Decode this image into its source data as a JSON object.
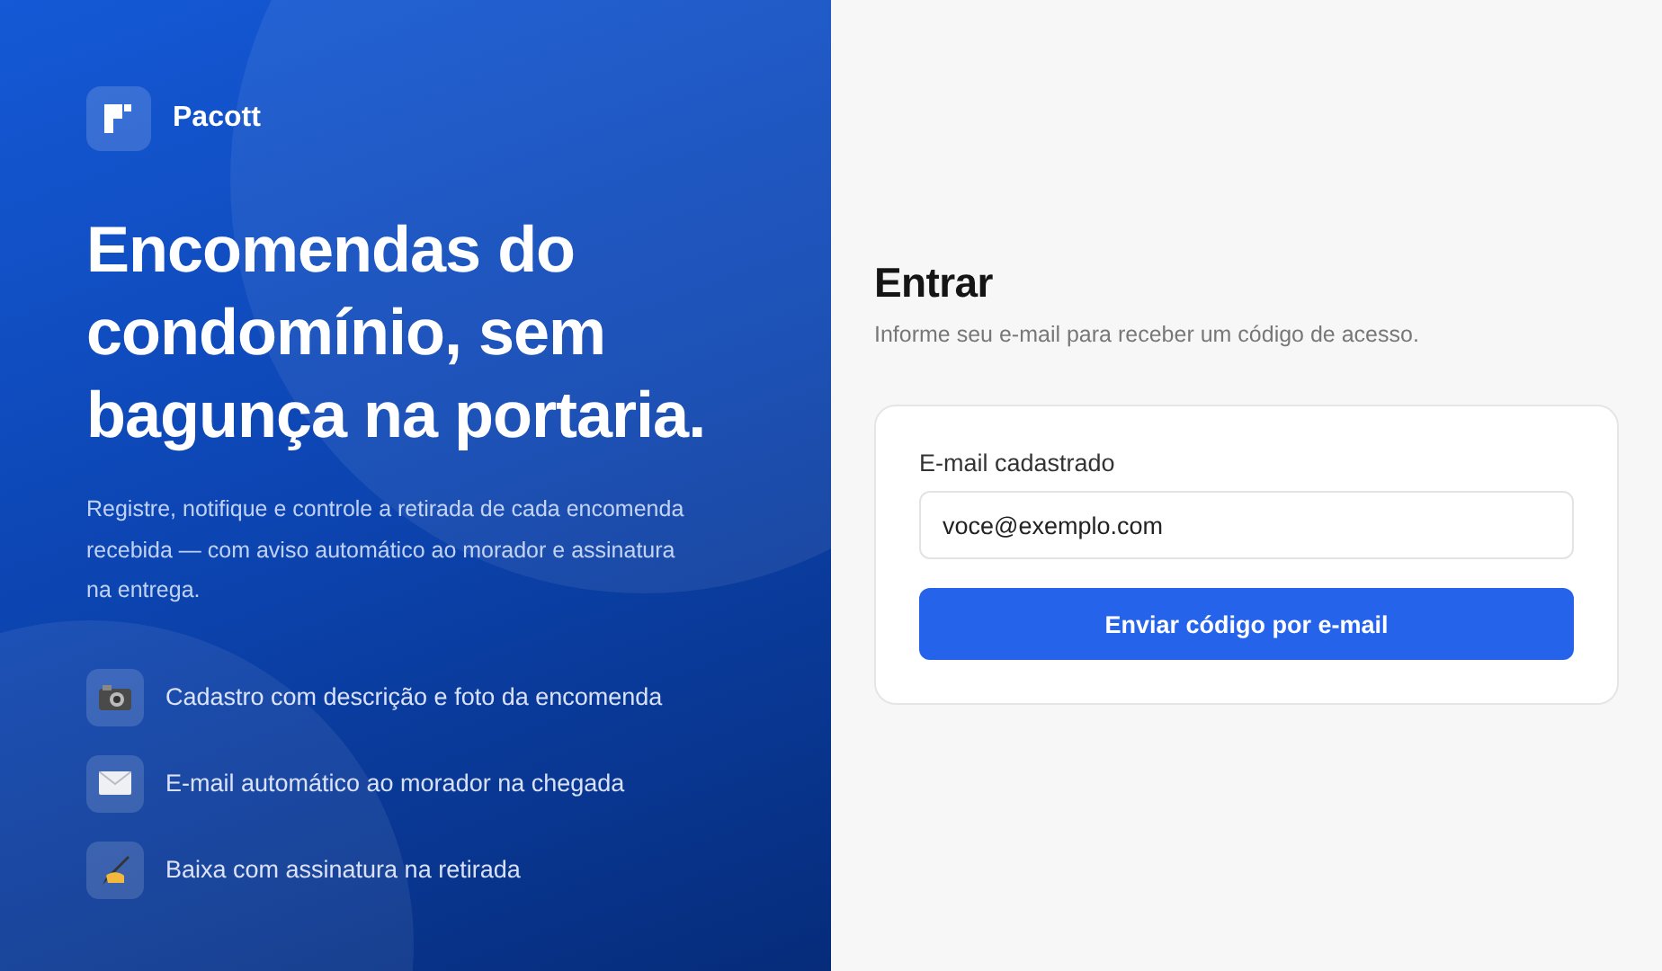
{
  "brand": {
    "name": "Pacott"
  },
  "hero": {
    "headline": "Encomendas do condomínio, sem bagunça na portaria.",
    "description": "Registre, notifique e controle a retirada de cada encomenda recebida — com aviso automático ao morador e assinatura na entrega."
  },
  "features": [
    {
      "kind": "camera",
      "label": "Cadastro com descrição e foto da encomenda"
    },
    {
      "kind": "envelope",
      "label": "E-mail automático ao morador na chegada"
    },
    {
      "kind": "writing",
      "label": "Baixa com assinatura na retirada"
    }
  ],
  "login": {
    "title": "Entrar",
    "subtitle": "Informe seu e-mail para receber um código de acesso.",
    "email_label": "E-mail cadastrado",
    "email_value": "voce@exemplo.com",
    "submit": "Enviar código por e-mail"
  }
}
